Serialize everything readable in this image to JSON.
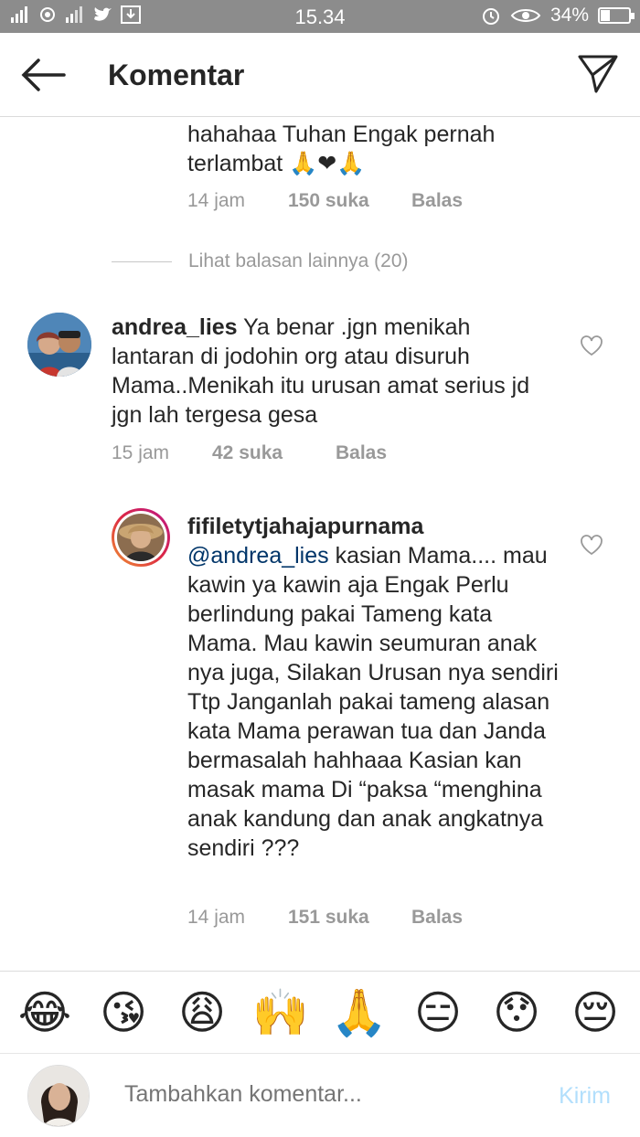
{
  "status_bar": {
    "left_icons": [
      "signal-icon",
      "notification-icon",
      "signal-2-icon",
      "twitter-icon",
      "download-icon"
    ],
    "time": "15.34",
    "alarm_icon": "alarm-icon",
    "eye_icon": "eye-icon",
    "battery_percent": "34%",
    "battery_level": 0.34
  },
  "header": {
    "title": "Komentar"
  },
  "comments": {
    "top_reply": {
      "text_line1": "hahahaa Tuhan Engak pernah",
      "text_line2": "terlambat 🙏❤🙏",
      "time": "14 jam",
      "likes": "150 suka",
      "reply": "Balas"
    },
    "view_more": "Lihat balasan lainnya (20)",
    "comment1": {
      "username": "andrea_lies",
      "text": "Ya benar .jgn menikah lantaran di jodohin org atau disuruh Mama..Menikah itu urusan amat serius jd jgn lah tergesa gesa",
      "time": "15 jam",
      "likes": "42 suka",
      "reply": "Balas"
    },
    "reply1": {
      "username": "fifiletytjahajapurnama",
      "mention": "@andrea_lies",
      "text": "kasian Mama.... mau kawin ya kawin aja Engak Perlu berlindung pakai Tameng kata Mama. Mau kawin seumuran anak nya juga, Silakan Urusan nya sendiri Ttp Janganlah pakai tameng alasan kata Mama perawan tua dan Janda bermasalah hahhaaa Kasian kan masak mama Di “paksa “menghina anak kandung dan anak angkatnya sendiri ???",
      "time": "14 jam",
      "likes": "151 suka",
      "reply": "Balas"
    }
  },
  "emoji_bar": [
    "😂",
    "😘",
    "😩",
    "🙌",
    "🙏",
    "😑",
    "😯",
    "😔"
  ],
  "composer": {
    "placeholder": "Tambahkan komentar...",
    "post_label": "Kirim"
  },
  "colors": {
    "status_bar": "#8c8c8c",
    "meta_text": "#999999",
    "mention": "#003569",
    "post_disabled": "#b2dffc",
    "story_ring_start": "#f09433",
    "story_ring_end": "#bc1888"
  }
}
